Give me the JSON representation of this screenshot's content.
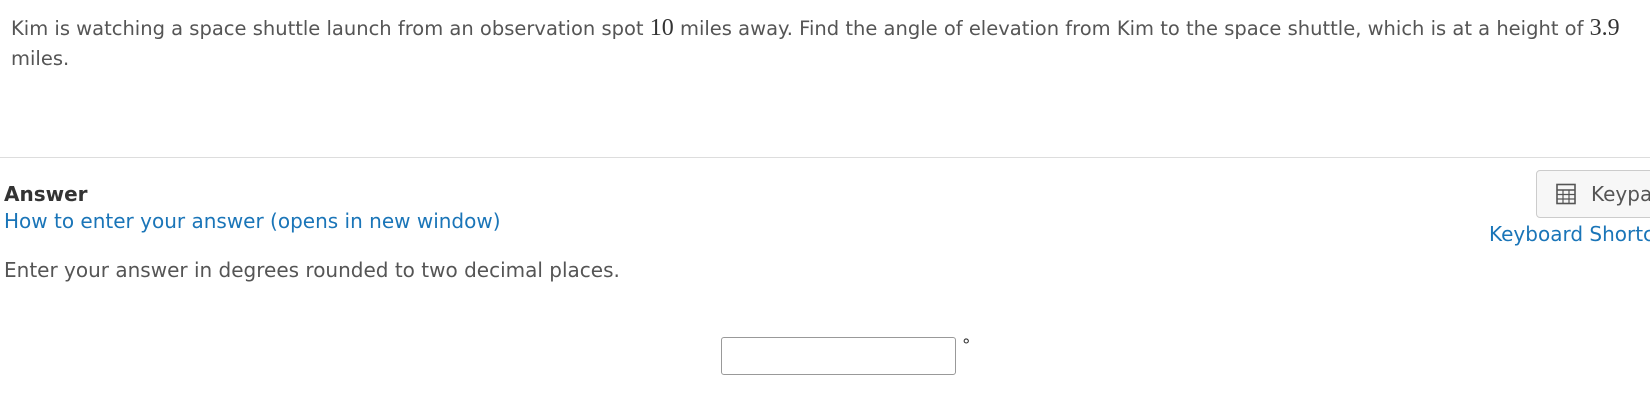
{
  "question": {
    "part1": "Kim is watching a space shuttle launch from an observation spot ",
    "distance": "10",
    "part2": " miles away.  Find the angle of elevation from Kim to the space shuttle, which is at a height of ",
    "height": "3.9",
    "part3": " miles."
  },
  "answer": {
    "heading": "Answer",
    "help_link": "How to enter your answer (opens in new window)",
    "instruction": "Enter your answer in degrees rounded to two decimal places.",
    "input_value": "",
    "unit_symbol": "°"
  },
  "toolbar": {
    "keypad_label": "Keypad",
    "keypad_icon": "calculator-icon",
    "shortcuts_label": "Keyboard Shortcuts"
  },
  "colors": {
    "link": "#1a75b8",
    "text": "#555555",
    "heading": "#333333"
  }
}
